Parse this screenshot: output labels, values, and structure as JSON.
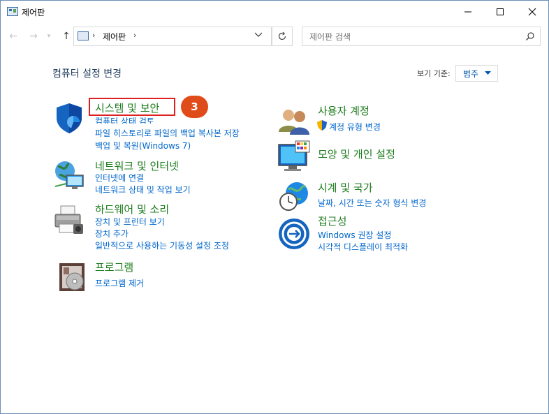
{
  "window": {
    "title": "제어판"
  },
  "nav": {
    "address_text": "제어판",
    "search_placeholder": "제어판 검색"
  },
  "content": {
    "heading": "컴퓨터 설정 변경",
    "view_by_label": "보기 기준:",
    "view_by_value": "범주"
  },
  "annotation": {
    "step_number": "3"
  },
  "categories": [
    {
      "title": "시스템 및 보안",
      "icon": "shield-icon",
      "links": [
        "컴퓨터 상태 검토",
        "파일 히스토리로 파일의 백업 복사본 저장",
        "백업 및 복원(Windows 7)"
      ]
    },
    {
      "title": "네트워크 및 인터넷",
      "icon": "network-globe-icon",
      "links": [
        "인터넷에 연결",
        "네트워크 상태 및 작업 보기"
      ]
    },
    {
      "title": "하드웨어 및 소리",
      "icon": "printer-icon",
      "links": [
        "장치 및 프린터 보기",
        "장치 추가",
        "일반적으로 사용하는 기동성 설정 조정"
      ]
    },
    {
      "title": "프로그램",
      "icon": "programs-disc-icon",
      "links": [
        "프로그램 제거"
      ]
    },
    {
      "title": "사용자 계정",
      "icon": "users-icon",
      "links": [
        "계정 유형 변경"
      ]
    },
    {
      "title": "모양 및 개인 설정",
      "icon": "monitor-color-icon",
      "links": []
    },
    {
      "title": "시계 및 국가",
      "icon": "clock-globe-icon",
      "links": [
        "날짜, 시간 또는 숫자 형식 변경"
      ]
    },
    {
      "title": "접근성",
      "icon": "accessibility-icon",
      "links": [
        "Windows 권장 설정",
        "시각적 디스플레이 최적화"
      ]
    }
  ],
  "colors": {
    "category_title": "#1c7b1c",
    "link": "#0066cc",
    "heading": "#1e395b",
    "highlight_border": "#e02020",
    "badge": "#e04b1a"
  }
}
